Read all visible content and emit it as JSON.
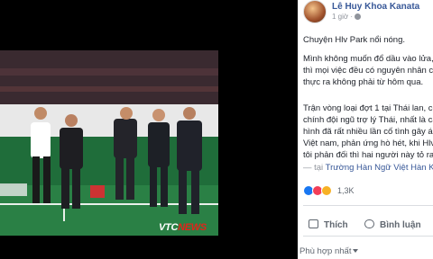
{
  "photo": {
    "watermark_a": "VTC",
    "watermark_b": "NEWS"
  },
  "post": {
    "author": "Lê Huy Khoa Kanata",
    "time": "1 giờ ·",
    "lines_1": [
      "Chuyện Hlv Park nổi nóng."
    ],
    "lines_2": [
      "Mình không muốn đổ dầu vào lửa,",
      "thì mọi việc đều có nguyên nhân c",
      "thực ra không phải từ hôm qua."
    ],
    "lines_3": [
      "Trận vòng loại đợt 1 tại Thái lan, có",
      "chính đội ngũ trợ lý Thái, nhất là ca",
      "hình đã rất nhiều lần cố tình gây áp",
      "Việt nam, phản ứng hò hét, khi Hlv",
      "tôi phản đối thì hai người này tỏ ra"
    ],
    "location_prefix": "— tại ",
    "location": "Trường Hàn Ngữ Việt Hàn Ka",
    "reactions": {
      "icons": [
        "like-icon",
        "love-icon",
        "haha-icon"
      ],
      "count": "1,3K"
    },
    "actions": {
      "like": "Thích",
      "comment": "Bình luận"
    },
    "sort": "Phù hợp nhất"
  }
}
